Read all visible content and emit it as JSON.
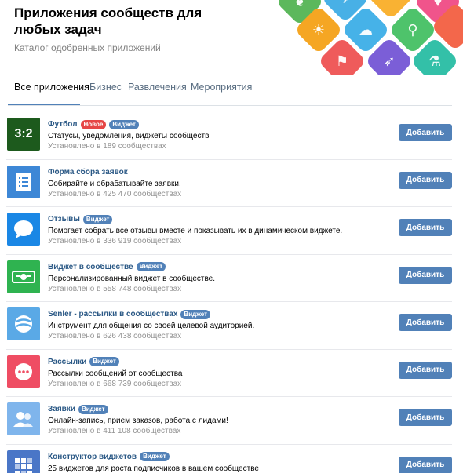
{
  "header": {
    "title": "Приложения сообществ для любых задач",
    "subtitle": "Каталог одобренных приложений"
  },
  "decoration": {
    "tiles": [
      {
        "icon": "leaf-icon",
        "glyph": "❦",
        "color": "#5cb85c"
      },
      {
        "icon": "plane-icon",
        "glyph": "✈",
        "color": "#48b0e6"
      },
      {
        "icon": "heart-icon",
        "glyph": "♥",
        "color": "#f0548b"
      },
      {
        "icon": "sun-icon",
        "glyph": "☀",
        "color": "#f5a623"
      },
      {
        "icon": "cloud-icon",
        "glyph": "☁",
        "color": "#46b2e8"
      },
      {
        "icon": "pin-icon",
        "glyph": "⚲",
        "color": "#4ec36b"
      },
      {
        "icon": "flag-icon",
        "glyph": "⚑",
        "color": "#ef5b5b"
      },
      {
        "icon": "rocket-icon",
        "glyph": "➶",
        "color": "#7b5ed7"
      },
      {
        "icon": "flask-icon",
        "glyph": "⚗",
        "color": "#33c0a8"
      },
      {
        "icon": "tile-icon",
        "glyph": "",
        "color": "#f9b233"
      },
      {
        "icon": "tile-icon",
        "glyph": "",
        "color": "#f3674b"
      }
    ]
  },
  "tabs": [
    {
      "label": "Все приложения",
      "active": true
    },
    {
      "label": "Бизнес",
      "active": false
    },
    {
      "label": "Развлечения",
      "active": false
    },
    {
      "label": "Мероприятия",
      "active": false
    }
  ],
  "apps": [
    {
      "name": "Футбол",
      "badges": [
        "Новое",
        "Виджет"
      ],
      "description": "Статусы, уведомления, виджеты сообществ",
      "installed": "Установлено в 189 сообществах",
      "button": "Добавить",
      "icon": "football-score-icon",
      "icon_text": "3:2",
      "icon_color": "#1d5a1d"
    },
    {
      "name": "Форма сбора заявок",
      "badges": [],
      "description": "Собирайте и обрабатывайте заявки.",
      "installed": "Установлено в 425 470 сообществах",
      "button": "Добавить",
      "icon": "form-icon",
      "icon_text": "",
      "icon_color": "#3d87d6"
    },
    {
      "name": "Отзывы",
      "badges": [
        "Виджет"
      ],
      "description": "Помогает собрать все отзывы вместе и показывать их в динамическом виджете.",
      "installed": "Установлено в 336 919 сообществах",
      "button": "Добавить",
      "icon": "chat-bubble-icon",
      "icon_text": "",
      "icon_color": "#1a87e5"
    },
    {
      "name": "Виджет в сообществе",
      "badges": [
        "Виджет"
      ],
      "description": "Персонализированный виджет в сообществе.",
      "installed": "Установлено в 558 748 сообществах",
      "button": "Добавить",
      "icon": "widget-icon",
      "icon_text": "",
      "icon_color": "#2fb350"
    },
    {
      "name": "Senler - рассылки в сообществах",
      "badges": [
        "Виджет"
      ],
      "description": "Инструмент для общения со своей целевой аудиторией.",
      "installed": "Установлено в 626 438 сообществах",
      "button": "Добавить",
      "icon": "senler-icon",
      "icon_text": "",
      "icon_color": "#5aa9e6"
    },
    {
      "name": "Рассылки",
      "badges": [
        "Виджет"
      ],
      "description": "Рассылки сообщений от сообщества",
      "installed": "Установлено в 668 739 сообществах",
      "button": "Добавить",
      "icon": "message-dots-icon",
      "icon_text": "",
      "icon_color": "#ef4d63"
    },
    {
      "name": "Заявки",
      "badges": [
        "Виджет"
      ],
      "description": "Онлайн-запись, прием заказов, работа с лидами!",
      "installed": "Установлено в 411 108 сообществах",
      "button": "Добавить",
      "icon": "users-icon",
      "icon_text": "",
      "icon_color": "#7fb5ec"
    },
    {
      "name": "Конструктор виджетов",
      "badges": [
        "Виджет"
      ],
      "description": "25 виджетов для роста подписчиков в вашем сообществе",
      "installed": "",
      "button": "Добавить",
      "icon": "constructor-icon",
      "icon_text": "",
      "icon_color": "#4a76c7"
    }
  ]
}
